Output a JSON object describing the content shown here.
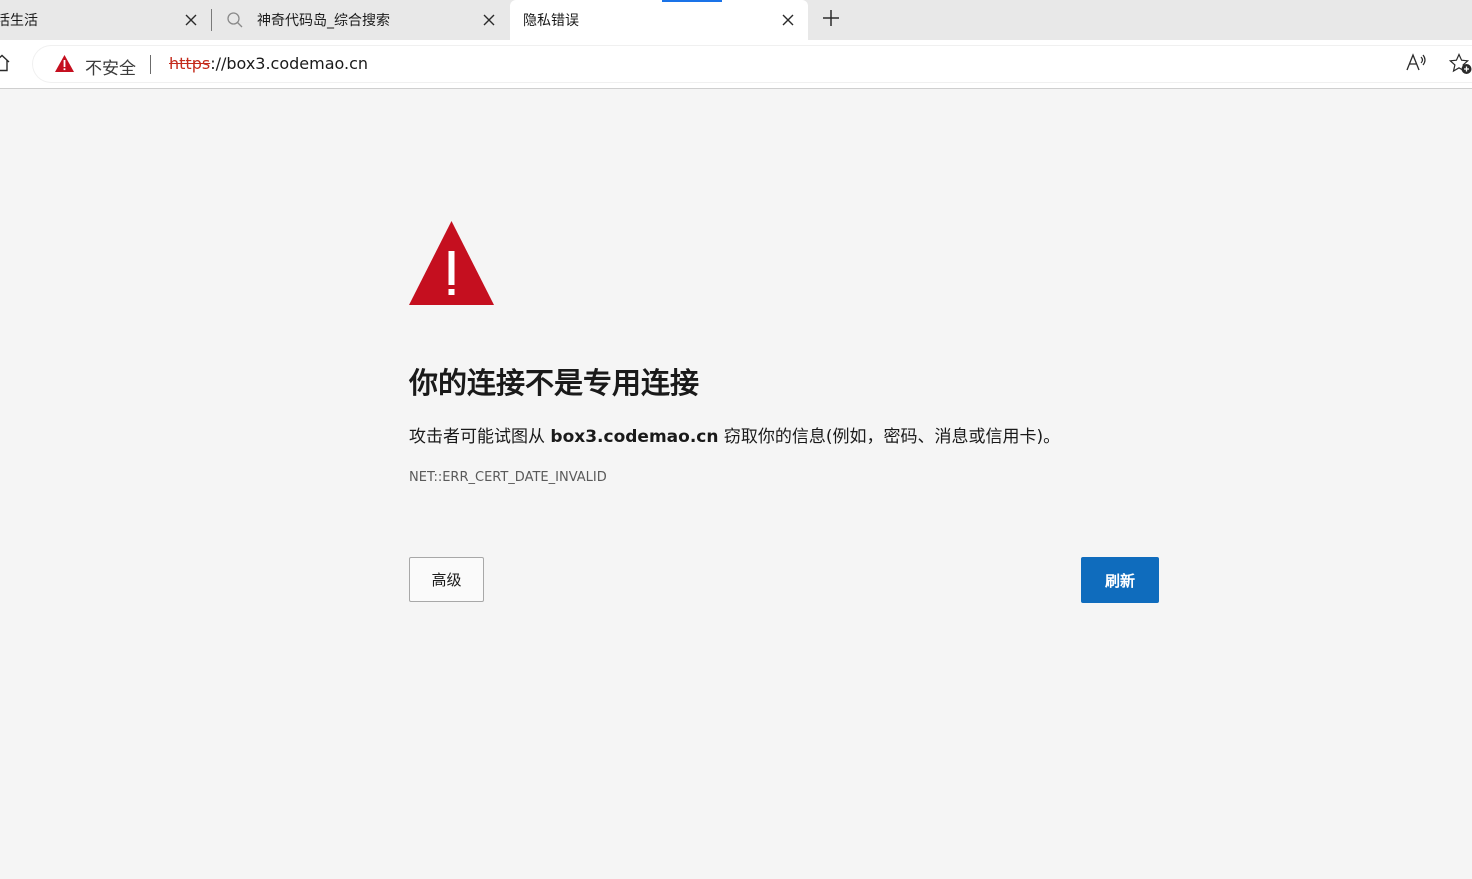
{
  "tabs": [
    {
      "label": "活生活",
      "close_icon": "close-icon"
    },
    {
      "label": "神奇代码岛_综合搜索",
      "icon": "search-icon",
      "close_icon": "close-icon"
    },
    {
      "label": "隐私错误",
      "close_icon": "close-icon",
      "active": true
    }
  ],
  "new_tab_icon": "plus-icon",
  "toolbar": {
    "home_icon": "home-icon",
    "security_icon": "warning-icon",
    "security_label": "不安全",
    "url_scheme": "https",
    "url_rest": "://box3.codemao.cn",
    "read_aloud_icon": "read-aloud-icon",
    "favorite_icon": "add-favorite-icon"
  },
  "error": {
    "icon": "warning-triangle-icon",
    "title": "你的连接不是专用连接",
    "desc_before": "攻击者可能试图从 ",
    "desc_host": "box3.codemao.cn",
    "desc_after": " 窃取你的信息(例如，密码、消息或信用卡)。",
    "code": "NET::ERR_CERT_DATE_INVALID",
    "advanced_label": "高级",
    "refresh_label": "刷新"
  },
  "colors": {
    "warning_red": "#c50f1f",
    "accent_blue": "#0f6cbd",
    "page_bg": "#f5f5f5"
  }
}
